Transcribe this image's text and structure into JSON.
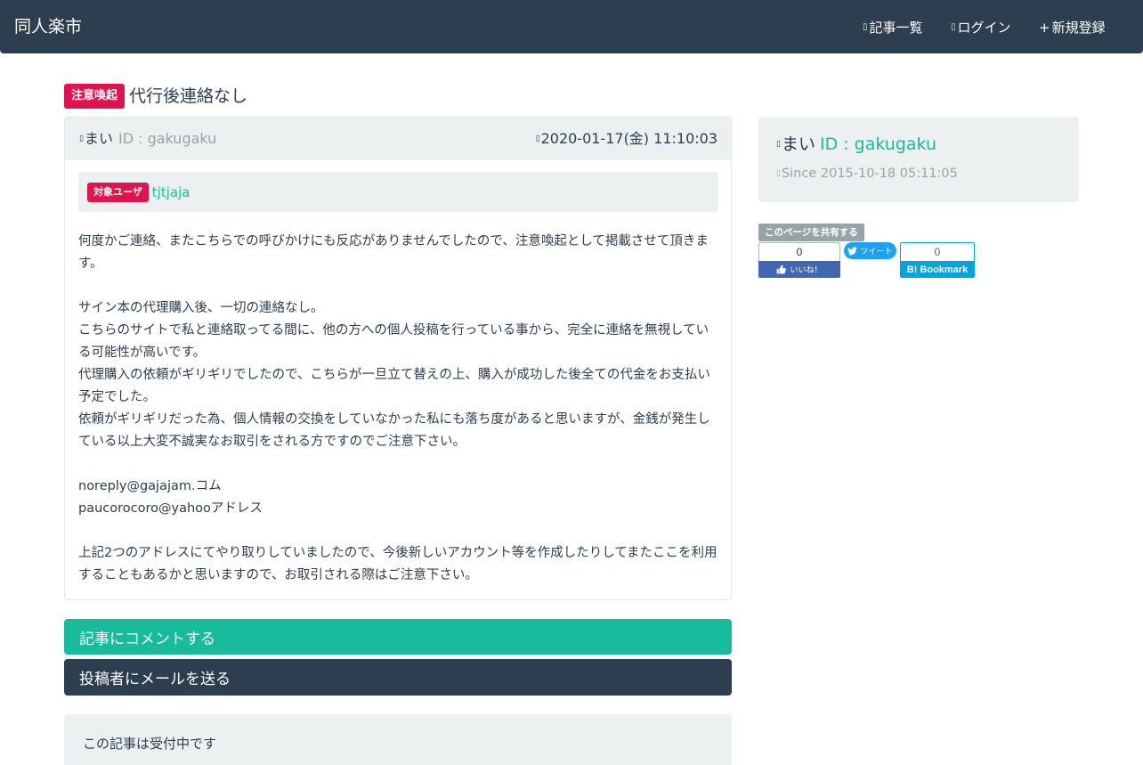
{
  "navbar": {
    "brand": "同人楽市",
    "items": [
      {
        "icon": "list-icon",
        "glyph": "▯",
        "label": "記事一覧"
      },
      {
        "icon": "login-icon",
        "glyph": "▯",
        "label": "ログイン"
      },
      {
        "icon": "plus-icon",
        "glyph": "+",
        "label": "新規登録"
      }
    ]
  },
  "article": {
    "badge": "注意喚起",
    "title": "代行後連絡なし",
    "author_icon": "▯",
    "author_name": "まい",
    "author_id": "ID : gakugaku",
    "date_icon": "▯",
    "date": "2020-01-17(金) 11:10:03",
    "target_badge": "対象ユーザ",
    "target_user": "tjtjaja",
    "body": {
      "p1": "何度かご連絡、またこちらでの呼びかけにも反応がありませんでしたので、注意喚起として掲載させて頂きます。",
      "p2": "サイン本の代理購入後、一切の連絡なし。",
      "p3": "こちらのサイトで私と連絡取ってる間に、他の方への個人投稿を行っている事から、完全に連絡を無視している可能性が高いです。",
      "p4": "代理購入の依頼がギリギリでしたので、こちらが一旦立て替えの上、購入が成功した後全ての代金をお支払い予定でした。",
      "p5": "依頼がギリギリだった為、個人情報の交換をしていなかった私にも落ち度があると思いますが、金銭が発生している以上大変不誠実なお取引をされる方ですのでご注意下さい。",
      "p6": "noreply@gajajam.コム",
      "p7": "paucorocoro@yahooアドレス",
      "p8": "上記2つのアドレスにてやり取りしていましたので、今後新しいアカウント等を作成したりしてまたここを利用することもあるかと思いますので、お取引される際はご注意下さい。"
    }
  },
  "actions": {
    "comment": "記事にコメントする",
    "mail": "投稿者にメールを送る"
  },
  "status": "この記事は受付中です",
  "profile": {
    "icon": "▯",
    "name": "まい",
    "id": "ID : gakugaku",
    "since_icon": "▯",
    "since": "Since 2015-10-18 05:11:05"
  },
  "share": {
    "label": "このページを共有する",
    "facebook_count": "0",
    "facebook_label": "いいね！",
    "twitter_label": "ツイート",
    "hatena_count": "0",
    "hatena_label": "Bookmark",
    "hatena_logo": "B!"
  },
  "colors": {
    "primary": "#2c3e50",
    "success": "#18bc9c",
    "danger": "#e0134d",
    "light": "#ecf0f1",
    "muted": "#95a5a6"
  }
}
